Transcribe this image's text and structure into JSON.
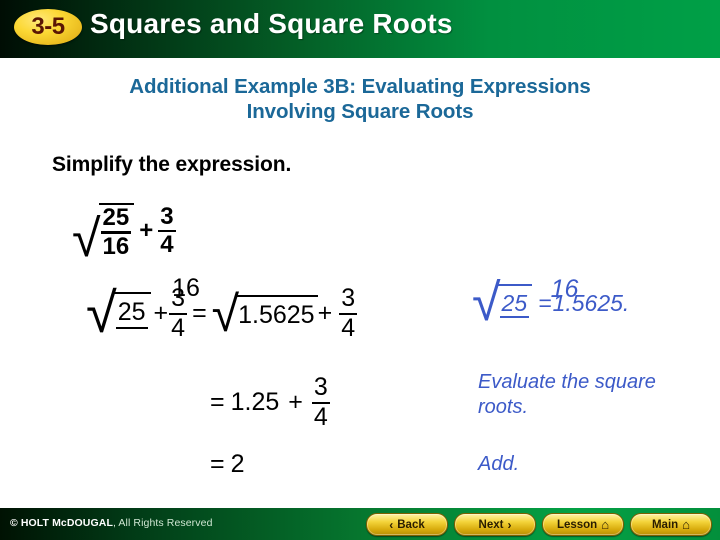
{
  "header": {
    "badge": "3-5",
    "title": "Squares and Square Roots"
  },
  "title": {
    "line1": "Additional Example 3B: Evaluating Expressions",
    "line2": "Involving Square Roots",
    "color": "#1b6898"
  },
  "instruction": "Simplify the expression.",
  "math": {
    "row1": {
      "radicand_num": "25",
      "radicand_den": "16",
      "plus": "+",
      "frac_num": "3",
      "frac_den": "4"
    },
    "row2": {
      "radicand_num": "25",
      "overlap_ghost": "16",
      "plus1": "+",
      "frac_num": "3",
      "frac_den": "4",
      "equals": "=",
      "radicand_decimal": "1.5625",
      "plus2": "+",
      "frac2_num": "3",
      "frac2_den": "4"
    },
    "row3": {
      "equals": "=",
      "value": "1.25",
      "plus": "+",
      "frac_num": "3",
      "frac_den": "4"
    },
    "row4": {
      "equals": "=",
      "value": "2"
    }
  },
  "annotations": {
    "expr": {
      "radicand_num": "25",
      "overlap_ghost": "16",
      "equals": "=",
      "value": "1.5625."
    },
    "note1": "Evaluate the square roots.",
    "note2": "Add.",
    "color": "#3c5ac8"
  },
  "footer": {
    "copyright_brand": "© HOLT McDOUGAL",
    "copyright_rest": ", All Rights Reserved",
    "buttons": [
      {
        "label": "Back",
        "glyph": "‹",
        "glyph_side": "left"
      },
      {
        "label": "Next",
        "glyph": "›",
        "glyph_side": "right"
      },
      {
        "label": "Lesson",
        "glyph": "⌂",
        "glyph_side": "right"
      },
      {
        "label": "Main",
        "glyph": "⌂",
        "glyph_side": "right"
      }
    ]
  }
}
